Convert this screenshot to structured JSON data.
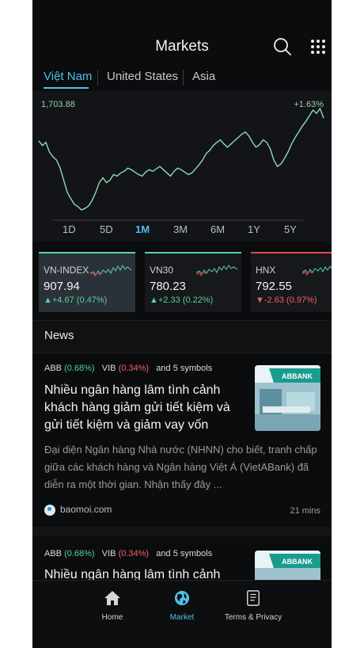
{
  "header": {
    "title": "Markets",
    "icons": [
      "search-icon",
      "grid-menu-icon"
    ]
  },
  "tabs": [
    {
      "label": "Việt Nam",
      "active": true
    },
    {
      "label": "United States",
      "active": false
    },
    {
      "label": "Asia",
      "active": false
    }
  ],
  "chart_data": {
    "type": "line",
    "value_label": "1,703.88",
    "change_label": "+1.63%",
    "color": "#8fd9b6",
    "x_ticks": [
      "1D",
      "5D",
      "1M",
      "3M",
      "6M",
      "1Y",
      "5Y"
    ],
    "selected_range": "1M",
    "y": [
      1703.88,
      1698,
      1702,
      1690,
      1684,
      1680,
      1670,
      1655,
      1640,
      1632,
      1625,
      1622,
      1618,
      1620,
      1623,
      1630,
      1640,
      1652,
      1658,
      1652,
      1655,
      1662,
      1660,
      1664,
      1666,
      1670,
      1668,
      1665,
      1662,
      1660,
      1665,
      1668,
      1666,
      1669,
      1672,
      1668,
      1664,
      1660,
      1666,
      1670,
      1668,
      1665,
      1662,
      1664,
      1669,
      1674,
      1680,
      1688,
      1692,
      1698,
      1702,
      1705,
      1700,
      1696,
      1700,
      1704,
      1708,
      1712,
      1715,
      1710,
      1702,
      1696,
      1699,
      1705,
      1702,
      1694,
      1680,
      1672,
      1675,
      1682,
      1690,
      1700,
      1708,
      1715,
      1722,
      1728,
      1735,
      1742,
      1738,
      1744,
      1732
    ]
  },
  "indices": [
    {
      "name": "VN-INDEX",
      "value": "907.94",
      "change": "▲+4.67",
      "pct": "(0.47%)",
      "direction": "up"
    },
    {
      "name": "VN30",
      "value": "780.23",
      "change": "▲+2.33",
      "pct": "(0.22%)",
      "direction": "up"
    },
    {
      "name": "HNX",
      "value": "792.55",
      "change": "▼-2.63",
      "pct": "(0.97%)",
      "direction": "down"
    }
  ],
  "news": {
    "section_title": "News",
    "articles": [
      {
        "symbol1": "ABB",
        "symbol1_pct": "(0.68%)",
        "symbol2": "VIB",
        "symbol2_pct": "(0.34%)",
        "more": "and 5 symbols",
        "headline": "Nhiều ngân hàng lâm tình cảnh khách hàng giảm gửi tiết kiệm và gửi tiết kiệm và giảm vay vốn",
        "summary": "Đại diện Ngân hàng Nhà nước (NHNN) cho biết, tranh chấp giữa các khách hàng và Ngân hàng Việt Á (VietABank) đã diễn ra một thời gian. Nhận thấy đây ...",
        "source": "baomoi.com",
        "time": "21 mins"
      },
      {
        "symbol1": "ABB",
        "symbol1_pct": "(0.68%)",
        "symbol2": "VIB",
        "symbol2_pct": "(0.34%)",
        "more": "and 5 symbols",
        "headline": "Nhiều ngân hàng lâm tình cảnh"
      }
    ]
  },
  "bottom_nav": [
    {
      "label": "Home",
      "icon": "home-icon",
      "active": false
    },
    {
      "label": "Market",
      "icon": "globe-icon",
      "active": true
    },
    {
      "label": "Terms & Privacy",
      "icon": "document-icon",
      "active": false
    }
  ]
}
